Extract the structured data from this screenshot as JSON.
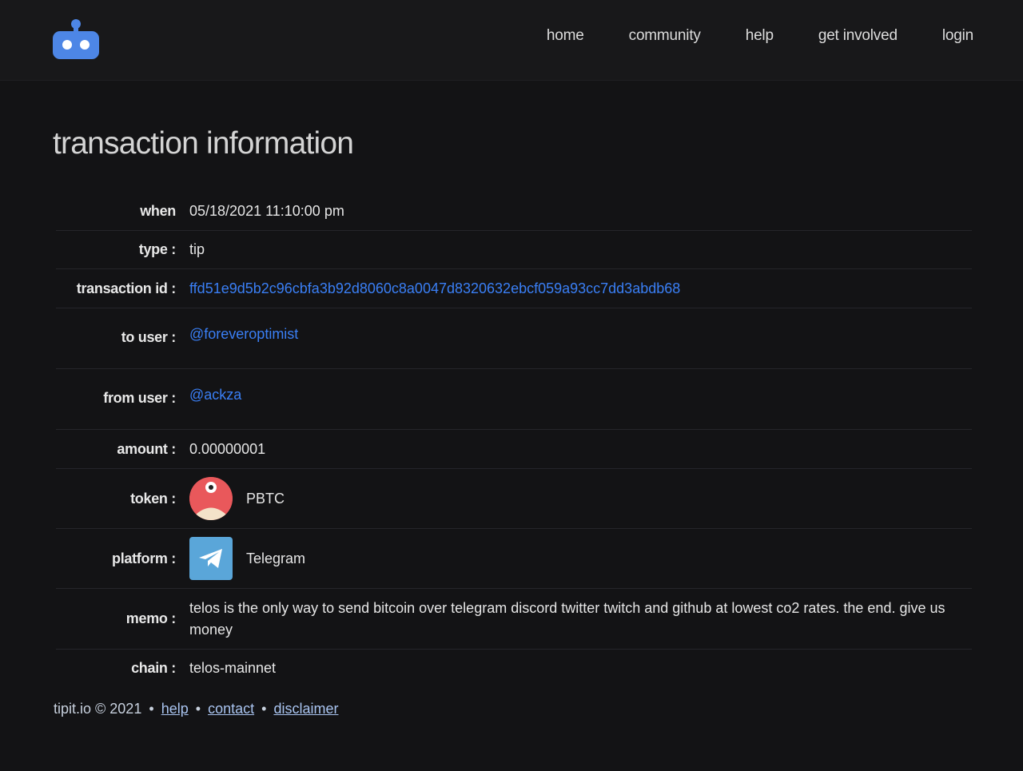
{
  "nav": {
    "items": [
      "home",
      "community",
      "help",
      "get involved",
      "login"
    ]
  },
  "page": {
    "title": "transaction information"
  },
  "transaction": {
    "when_label": "when",
    "when_value": "05/18/2021 11:10:00 pm",
    "type_label": "type :",
    "type_value": "tip",
    "txid_label": "transaction id :",
    "txid_value": "ffd51e9d5b2c96cbfa3b92d8060c8a0047d8320632ebcf059a93cc7dd3abdb68",
    "to_label": "to user :",
    "to_value": "@foreveroptimist",
    "from_label": "from user :",
    "from_value": "@ackza",
    "amount_label": "amount :",
    "amount_value": "0.00000001",
    "token_label": "token :",
    "token_value": "PBTC",
    "platform_label": "platform :",
    "platform_value": "Telegram",
    "memo_label": "memo :",
    "memo_value": "telos is the only way to send bitcoin over telegram discord twitter twitch and github at lowest co2 rates. the end. give us money",
    "chain_label": "chain :",
    "chain_value": "telos-mainnet"
  },
  "footer": {
    "brand": "tipit.io © 2021",
    "sep": "•",
    "help": "help",
    "contact": "contact",
    "disclaimer": "disclaimer"
  },
  "icons": {
    "logo": "robot-icon",
    "token": "pbtc-token-icon",
    "platform": "telegram-icon"
  },
  "colors": {
    "accent": "#3a7ff5",
    "background": "#131315",
    "header": "#18181a"
  }
}
